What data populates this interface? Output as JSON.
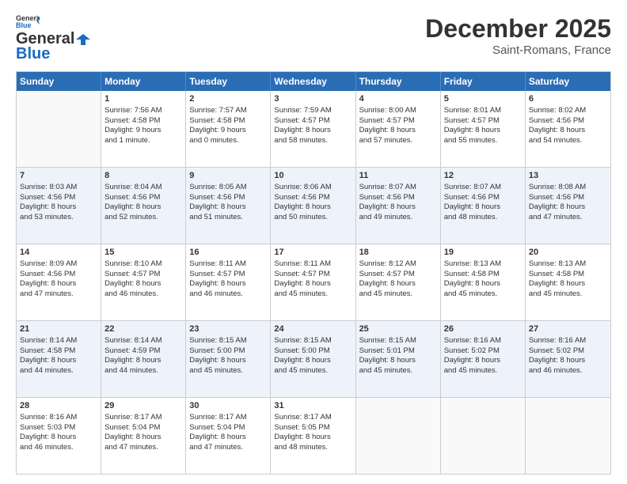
{
  "header": {
    "logo_line1": "General",
    "logo_line2": "Blue",
    "month_title": "December 2025",
    "location": "Saint-Romans, France"
  },
  "days_of_week": [
    "Sunday",
    "Monday",
    "Tuesday",
    "Wednesday",
    "Thursday",
    "Friday",
    "Saturday"
  ],
  "weeks": [
    [
      {
        "day": "",
        "empty": true,
        "content": ""
      },
      {
        "day": "1",
        "content": "Sunrise: 7:56 AM\nSunset: 4:58 PM\nDaylight: 9 hours\nand 1 minute."
      },
      {
        "day": "2",
        "content": "Sunrise: 7:57 AM\nSunset: 4:58 PM\nDaylight: 9 hours\nand 0 minutes."
      },
      {
        "day": "3",
        "content": "Sunrise: 7:59 AM\nSunset: 4:57 PM\nDaylight: 8 hours\nand 58 minutes."
      },
      {
        "day": "4",
        "content": "Sunrise: 8:00 AM\nSunset: 4:57 PM\nDaylight: 8 hours\nand 57 minutes."
      },
      {
        "day": "5",
        "content": "Sunrise: 8:01 AM\nSunset: 4:57 PM\nDaylight: 8 hours\nand 55 minutes."
      },
      {
        "day": "6",
        "content": "Sunrise: 8:02 AM\nSunset: 4:56 PM\nDaylight: 8 hours\nand 54 minutes."
      }
    ],
    [
      {
        "day": "7",
        "content": "Sunrise: 8:03 AM\nSunset: 4:56 PM\nDaylight: 8 hours\nand 53 minutes."
      },
      {
        "day": "8",
        "content": "Sunrise: 8:04 AM\nSunset: 4:56 PM\nDaylight: 8 hours\nand 52 minutes."
      },
      {
        "day": "9",
        "content": "Sunrise: 8:05 AM\nSunset: 4:56 PM\nDaylight: 8 hours\nand 51 minutes."
      },
      {
        "day": "10",
        "content": "Sunrise: 8:06 AM\nSunset: 4:56 PM\nDaylight: 8 hours\nand 50 minutes."
      },
      {
        "day": "11",
        "content": "Sunrise: 8:07 AM\nSunset: 4:56 PM\nDaylight: 8 hours\nand 49 minutes."
      },
      {
        "day": "12",
        "content": "Sunrise: 8:07 AM\nSunset: 4:56 PM\nDaylight: 8 hours\nand 48 minutes."
      },
      {
        "day": "13",
        "content": "Sunrise: 8:08 AM\nSunset: 4:56 PM\nDaylight: 8 hours\nand 47 minutes."
      }
    ],
    [
      {
        "day": "14",
        "content": "Sunrise: 8:09 AM\nSunset: 4:56 PM\nDaylight: 8 hours\nand 47 minutes."
      },
      {
        "day": "15",
        "content": "Sunrise: 8:10 AM\nSunset: 4:57 PM\nDaylight: 8 hours\nand 46 minutes."
      },
      {
        "day": "16",
        "content": "Sunrise: 8:11 AM\nSunset: 4:57 PM\nDaylight: 8 hours\nand 46 minutes."
      },
      {
        "day": "17",
        "content": "Sunrise: 8:11 AM\nSunset: 4:57 PM\nDaylight: 8 hours\nand 45 minutes."
      },
      {
        "day": "18",
        "content": "Sunrise: 8:12 AM\nSunset: 4:57 PM\nDaylight: 8 hours\nand 45 minutes."
      },
      {
        "day": "19",
        "content": "Sunrise: 8:13 AM\nSunset: 4:58 PM\nDaylight: 8 hours\nand 45 minutes."
      },
      {
        "day": "20",
        "content": "Sunrise: 8:13 AM\nSunset: 4:58 PM\nDaylight: 8 hours\nand 45 minutes."
      }
    ],
    [
      {
        "day": "21",
        "content": "Sunrise: 8:14 AM\nSunset: 4:58 PM\nDaylight: 8 hours\nand 44 minutes."
      },
      {
        "day": "22",
        "content": "Sunrise: 8:14 AM\nSunset: 4:59 PM\nDaylight: 8 hours\nand 44 minutes."
      },
      {
        "day": "23",
        "content": "Sunrise: 8:15 AM\nSunset: 5:00 PM\nDaylight: 8 hours\nand 45 minutes."
      },
      {
        "day": "24",
        "content": "Sunrise: 8:15 AM\nSunset: 5:00 PM\nDaylight: 8 hours\nand 45 minutes."
      },
      {
        "day": "25",
        "content": "Sunrise: 8:15 AM\nSunset: 5:01 PM\nDaylight: 8 hours\nand 45 minutes."
      },
      {
        "day": "26",
        "content": "Sunrise: 8:16 AM\nSunset: 5:02 PM\nDaylight: 8 hours\nand 45 minutes."
      },
      {
        "day": "27",
        "content": "Sunrise: 8:16 AM\nSunset: 5:02 PM\nDaylight: 8 hours\nand 46 minutes."
      }
    ],
    [
      {
        "day": "28",
        "content": "Sunrise: 8:16 AM\nSunset: 5:03 PM\nDaylight: 8 hours\nand 46 minutes."
      },
      {
        "day": "29",
        "content": "Sunrise: 8:17 AM\nSunset: 5:04 PM\nDaylight: 8 hours\nand 47 minutes."
      },
      {
        "day": "30",
        "content": "Sunrise: 8:17 AM\nSunset: 5:04 PM\nDaylight: 8 hours\nand 47 minutes."
      },
      {
        "day": "31",
        "content": "Sunrise: 8:17 AM\nSunset: 5:05 PM\nDaylight: 8 hours\nand 48 minutes."
      },
      {
        "day": "",
        "empty": true,
        "content": ""
      },
      {
        "day": "",
        "empty": true,
        "content": ""
      },
      {
        "day": "",
        "empty": true,
        "content": ""
      }
    ]
  ]
}
